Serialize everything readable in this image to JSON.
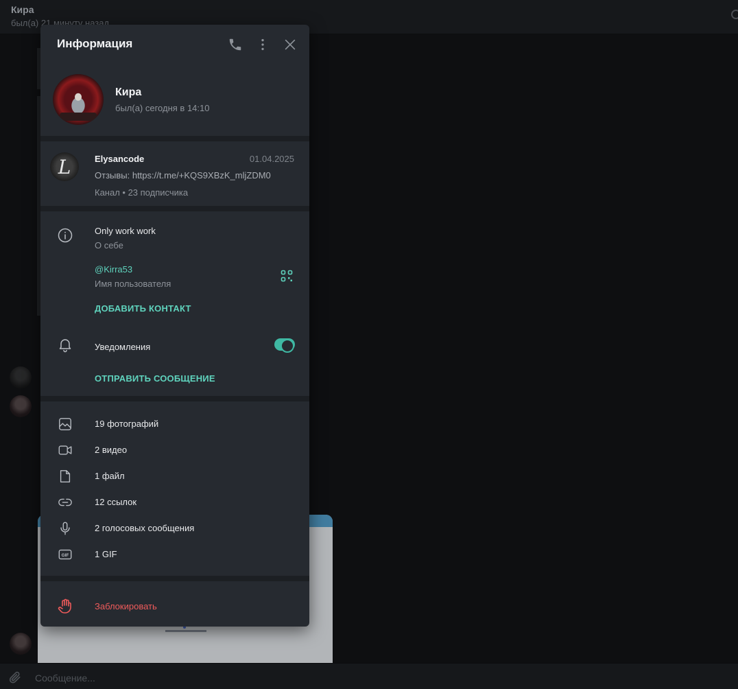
{
  "chat": {
    "title": "Кира",
    "status": "был(а) 21 минуту назад",
    "composer_placeholder": "Сообщение..."
  },
  "panel": {
    "title": "Информация",
    "icons": {
      "call": "phone-icon",
      "more": "more-vertical-icon",
      "close": "close-icon"
    }
  },
  "profile": {
    "name": "Кира",
    "status": "был(а) сегодня в 14:10"
  },
  "channel": {
    "name": "Elysancode",
    "date": "01.04.2025",
    "text": "Отзывы: https://t.me/+KQS9XBzK_mljZDM0",
    "meta": "Канал • 23 подписчика",
    "avatar_letter": "L"
  },
  "about": {
    "bio": "Only work work",
    "bio_label": "О себе",
    "username": "@Kirra53",
    "username_label": "Имя пользователя",
    "add_contact": "ДОБАВИТЬ КОНТАКТ",
    "notifications_label": "Уведомления",
    "notifications_on": true,
    "send_message": "ОТПРАВИТЬ СООБЩЕНИЕ"
  },
  "media": [
    {
      "icon": "photo-icon",
      "label": "19 фотографий"
    },
    {
      "icon": "video-icon",
      "label": "2 видео"
    },
    {
      "icon": "file-icon",
      "label": "1 файл"
    },
    {
      "icon": "link-icon",
      "label": "12 ссылок"
    },
    {
      "icon": "microphone-icon",
      "label": "2 голосовых сообщения"
    },
    {
      "icon": "gif-icon",
      "label": "1 GIF"
    }
  ],
  "block": {
    "label": "Заблокировать",
    "icon": "hand-stop-icon"
  },
  "colors": {
    "accent": "#5fd3bd",
    "danger": "#ef5b5b",
    "panel_bg": "#262a30"
  }
}
